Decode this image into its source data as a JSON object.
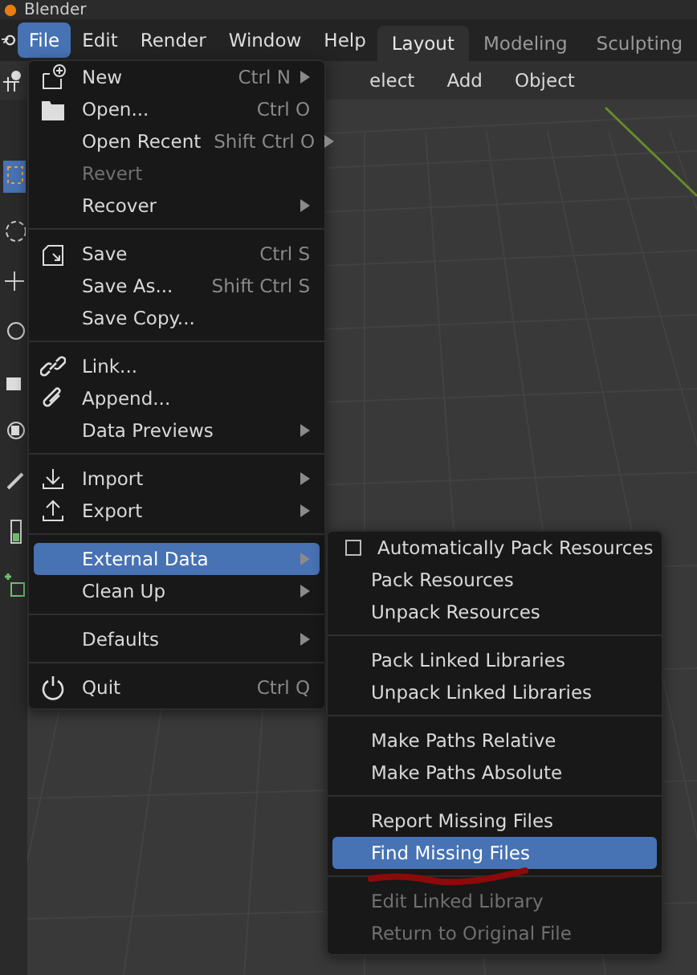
{
  "window": {
    "title": "Blender"
  },
  "menu_bar": {
    "items": [
      {
        "label": "File",
        "selected": true
      },
      {
        "label": "Edit",
        "selected": false
      },
      {
        "label": "Render",
        "selected": false
      },
      {
        "label": "Window",
        "selected": false
      },
      {
        "label": "Help",
        "selected": false
      }
    ]
  },
  "workspace_tabs": [
    {
      "label": "Layout",
      "selected": true
    },
    {
      "label": "Modeling",
      "selected": false
    },
    {
      "label": "Sculpting",
      "selected": false
    }
  ],
  "header": {
    "items": [
      "elect",
      "Add",
      "Object"
    ]
  },
  "file_menu": {
    "groups": [
      [
        {
          "label": "New",
          "shortcut": "Ctrl N",
          "submenu": true,
          "disabled": false,
          "selected": false
        },
        {
          "label": "Open...",
          "shortcut": "Ctrl O",
          "submenu": false,
          "disabled": false,
          "selected": false
        },
        {
          "label": "Open Recent",
          "shortcut": "Shift Ctrl O",
          "submenu": true,
          "disabled": false,
          "selected": false
        },
        {
          "label": "Revert",
          "submenu": false,
          "disabled": true,
          "selected": false
        },
        {
          "label": "Recover",
          "submenu": true,
          "disabled": false,
          "selected": false
        }
      ],
      [
        {
          "label": "Save",
          "shortcut": "Ctrl S",
          "submenu": false,
          "disabled": false,
          "selected": false
        },
        {
          "label": "Save As...",
          "shortcut": "Shift Ctrl S",
          "submenu": false,
          "disabled": false,
          "selected": false
        },
        {
          "label": "Save Copy...",
          "submenu": false,
          "disabled": false,
          "selected": false
        }
      ],
      [
        {
          "label": "Link...",
          "submenu": false,
          "disabled": false,
          "selected": false
        },
        {
          "label": "Append...",
          "submenu": false,
          "disabled": false,
          "selected": false
        },
        {
          "label": "Data Previews",
          "submenu": true,
          "disabled": false,
          "selected": false
        }
      ],
      [
        {
          "label": "Import",
          "submenu": true,
          "disabled": false,
          "selected": false
        },
        {
          "label": "Export",
          "submenu": true,
          "disabled": false,
          "selected": false
        }
      ],
      [
        {
          "label": "External Data",
          "submenu": true,
          "disabled": false,
          "selected": true
        },
        {
          "label": "Clean Up",
          "submenu": true,
          "disabled": false,
          "selected": false
        }
      ],
      [
        {
          "label": "Defaults",
          "submenu": true,
          "disabled": false,
          "selected": false
        }
      ],
      [
        {
          "label": "Quit",
          "shortcut": "Ctrl Q",
          "submenu": false,
          "disabled": false,
          "selected": false
        }
      ]
    ]
  },
  "external_data_menu": {
    "groups": [
      [
        {
          "kind": "checkbox",
          "label": "Automatically Pack Resources",
          "checked": false,
          "disabled": false,
          "selected": false
        },
        {
          "kind": "action",
          "label": "Pack Resources",
          "disabled": false,
          "selected": false
        },
        {
          "kind": "action",
          "label": "Unpack Resources",
          "disabled": false,
          "selected": false
        }
      ],
      [
        {
          "kind": "action",
          "label": "Pack Linked Libraries",
          "disabled": false,
          "selected": false
        },
        {
          "kind": "action",
          "label": "Unpack Linked Libraries",
          "disabled": false,
          "selected": false
        }
      ],
      [
        {
          "kind": "action",
          "label": "Make Paths Relative",
          "disabled": false,
          "selected": false
        },
        {
          "kind": "action",
          "label": "Make Paths Absolute",
          "disabled": false,
          "selected": false
        }
      ],
      [
        {
          "kind": "action",
          "label": "Report Missing Files",
          "disabled": false,
          "selected": false
        },
        {
          "kind": "action",
          "label": "Find Missing Files",
          "disabled": false,
          "selected": true
        }
      ],
      [
        {
          "kind": "action",
          "label": "Edit Linked Library",
          "disabled": true,
          "selected": false
        },
        {
          "kind": "action",
          "label": "Return to Original File",
          "disabled": true,
          "selected": false
        }
      ]
    ]
  }
}
